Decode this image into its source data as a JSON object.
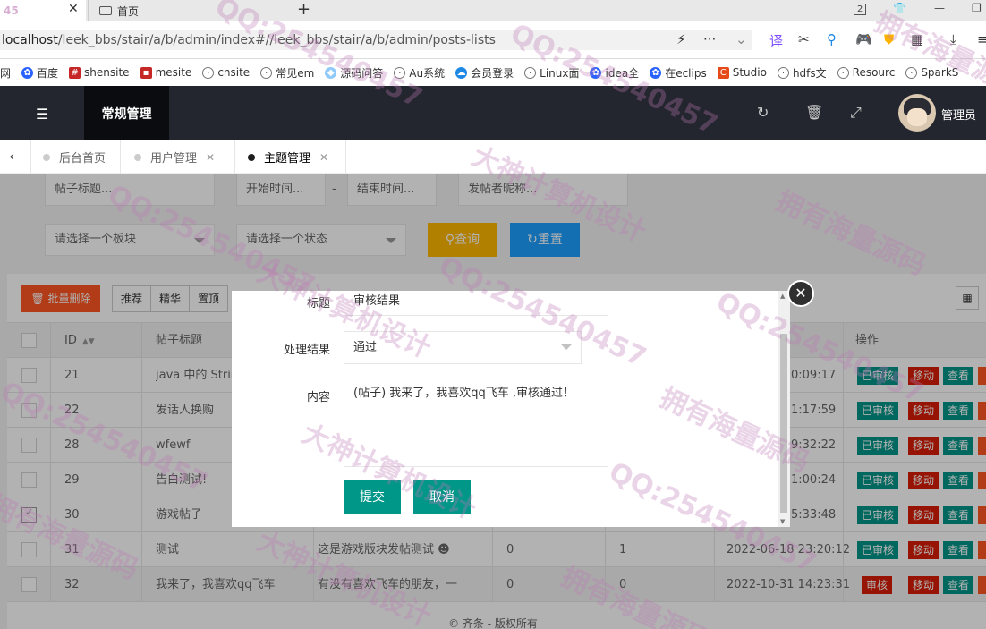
{
  "browser": {
    "tab_fragment": "45",
    "tab2_title": "首页",
    "tab_count": "2",
    "url_host": "localhost",
    "url_path": "/leek_bbs/stair/a/b/admin/index#//leek_bbs/stair/a/b/admin/posts-lists",
    "bookmarks": [
      "网",
      "百度",
      "shensite",
      "mesite",
      "cnsite",
      "常见em",
      "源码问答",
      "Au系统",
      "会员登录",
      "Linux面",
      "idea全",
      "在eclips",
      "Studio",
      "hdfs文",
      "Resourc",
      "SparkS"
    ]
  },
  "header": {
    "title": "常规管理",
    "admin_name": "管理员"
  },
  "page_tabs": [
    {
      "label": "后台首页",
      "active": false,
      "closable": false
    },
    {
      "label": "用户管理",
      "active": false,
      "closable": true
    },
    {
      "label": "主题管理",
      "active": true,
      "closable": true
    }
  ],
  "filters": {
    "title_placeholder": "帖子标题...",
    "start_placeholder": "开始时间...",
    "end_placeholder": "结束时间...",
    "author_placeholder": "发帖者昵称...",
    "board_select": "请选择一个板块",
    "status_select": "请选择一个状态",
    "query_label": "查询",
    "reset_label": "重置",
    "dash": "-"
  },
  "toolbar": {
    "batch_delete": "批量删除",
    "recommend": "推荐",
    "featured": "精华",
    "top": "置顶"
  },
  "table": {
    "headers": {
      "id": "ID",
      "title": "帖子标题",
      "ops": "操作"
    },
    "rows": [
      {
        "id": "21",
        "title": "java 中的 Strin",
        "content": "",
        "c1": "",
        "c2": "",
        "time": "0:09:17",
        "status": "已审核",
        "checked": false
      },
      {
        "id": "22",
        "title": "发话人换购",
        "content": "",
        "c1": "",
        "c2": "",
        "time": "1:17:59",
        "status": "已审核",
        "checked": false
      },
      {
        "id": "28",
        "title": "wfewf",
        "content": "",
        "c1": "",
        "c2": "",
        "time": "9:32:22",
        "status": "已审核",
        "checked": false
      },
      {
        "id": "29",
        "title": "告白测试!",
        "content": "",
        "c1": "",
        "c2": "",
        "time": "1:00:24",
        "status": "已审核",
        "checked": false
      },
      {
        "id": "30",
        "title": "游戏帖子",
        "content": "",
        "c1": "",
        "c2": "",
        "time": "5:33:48",
        "status": "已审核",
        "checked": true
      },
      {
        "id": "31",
        "title": "测试",
        "content": "这是游戏版块发帖测试",
        "c1": "0",
        "c2": "1",
        "time": "2022-06-18 23:20:12",
        "status": "已审核",
        "checked": false
      },
      {
        "id": "32",
        "title": "我来了，我喜欢qq飞车",
        "content": "有没有喜欢飞车的朋友，一",
        "c1": "0",
        "c2": "0",
        "time": "2022-10-31 14:23:31",
        "status": "审核",
        "checked": false
      }
    ],
    "move_label": "移动",
    "view_label": "查看"
  },
  "modal": {
    "title_label": "标题",
    "title_value": "审核结果",
    "result_label": "处理结果",
    "result_value": "通过",
    "content_label": "内容",
    "content_value": "(帖子) 我来了，我喜欢qq飞车 ,审核通过！",
    "submit_label": "提交",
    "cancel_label": "取消"
  },
  "footer": "© 齐条 - 版权所有",
  "watermarks": [
    "QQ:254540457",
    "大神计算机设计",
    "拥有海量源码"
  ],
  "colors": {
    "header_bg": "#23262e",
    "primary_green": "#009688",
    "danger_red": "#d81e06",
    "warn_orange": "#ff5722",
    "query_yellow": "#ffb800",
    "reset_blue": "#1e9fff"
  }
}
